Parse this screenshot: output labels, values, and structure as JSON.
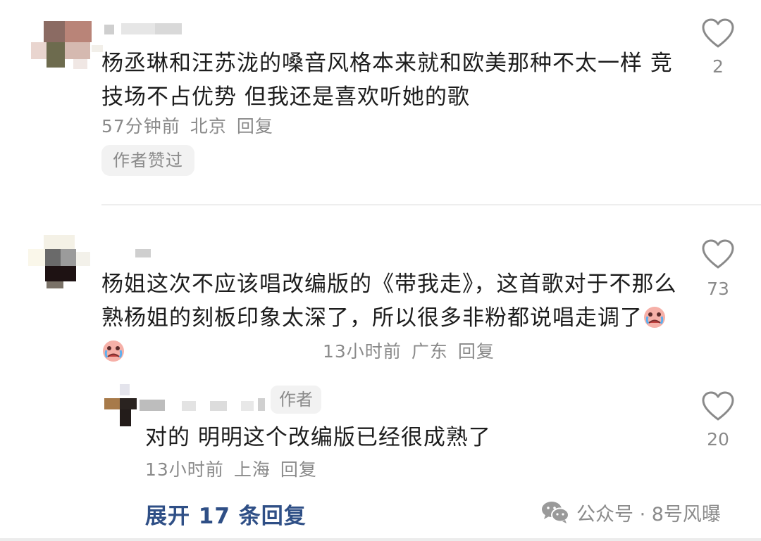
{
  "comments": [
    {
      "text": "杨丞琳和汪苏泷的嗓音风格本来就和欧美那种不太一样 竞技场不占优势 但我还是喜欢听她的歌",
      "time": "57分钟前",
      "location": "北京",
      "reply_label": "回复",
      "author_liked_label": "作者赞过",
      "like_count": "2"
    },
    {
      "text": "杨姐这次不应该唱改编版的《带我走》，这首歌对于不那么熟杨姐的刻板印象太深了，所以很多非粉都说唱走调了",
      "time": "13小时前",
      "location": "广东",
      "reply_label": "回复",
      "like_count": "73",
      "emoji": "crying-face-emoji"
    }
  ],
  "reply": {
    "author_tag": "作者",
    "text": "对的 明明这个改编版已经很成熟了",
    "time": "13小时前",
    "location": "上海",
    "reply_label": "回复",
    "like_count": "20"
  },
  "expand_replies_label": "展开 17 条回复",
  "watermark": {
    "icon": "wechat-icon",
    "text": "公众号 · 8号风曝"
  },
  "colors": {
    "link_blue": "#2f4f86",
    "meta_gray": "#8a8a8a",
    "tag_bg": "#f2f2f2"
  }
}
